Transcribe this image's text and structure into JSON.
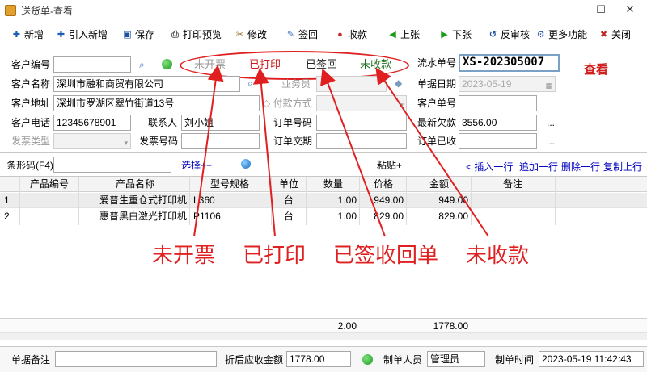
{
  "window": {
    "title": "送货单-查看",
    "min": "—",
    "max": "☐",
    "close": "✕"
  },
  "toolbar": [
    {
      "key": "add",
      "label": "新增",
      "icon": "plus-icon",
      "glyph": "✚",
      "color": "#1a5fb4"
    },
    {
      "key": "import",
      "label": "引入新增",
      "icon": "plus-icon",
      "glyph": "✚",
      "color": "#1a5fb4"
    },
    {
      "key": "save",
      "label": "保存",
      "icon": "floppy-icon",
      "glyph": "▣",
      "color": "#2050a0"
    },
    {
      "key": "print_preview",
      "label": "打印预览",
      "icon": "printer-icon",
      "glyph": "⎙",
      "color": "#555555"
    },
    {
      "key": "modify",
      "label": "修改",
      "icon": "scissors-icon",
      "glyph": "✂",
      "color": "#8a6a20"
    },
    {
      "key": "sign",
      "label": "签回",
      "icon": "sign-icon",
      "glyph": "✎",
      "color": "#3a70c0"
    },
    {
      "key": "receive",
      "label": "收款",
      "icon": "coins-icon",
      "glyph": "●",
      "color": "#c03030"
    },
    {
      "key": "prev",
      "label": "上张",
      "icon": "arrow-left-icon",
      "glyph": "◀",
      "color": "#1a9a1a"
    },
    {
      "key": "next",
      "label": "下张",
      "icon": "arrow-right-icon",
      "glyph": "▶",
      "color": "#1a9a1a"
    },
    {
      "key": "unaudit",
      "label": "反审核",
      "icon": "unaudit-icon",
      "glyph": "↺",
      "color": "#2050a0"
    },
    {
      "key": "more",
      "label": "更多功能",
      "icon": "gear-icon",
      "glyph": "⚙",
      "color": "#2050a0"
    },
    {
      "key": "close",
      "label": "关闭",
      "icon": "close-icon",
      "glyph": "✖",
      "color": "#c02020"
    }
  ],
  "status": {
    "invoice": "未开票",
    "printed": "已打印",
    "signed": "已签回",
    "payment": "未收款"
  },
  "view_mark": "查看",
  "form": {
    "customer_no_label": "客户编号",
    "customer_no": "",
    "customer_name_label": "客户名称",
    "customer_name": "深圳市融和商贸有限公司",
    "salesman_label": "业务员",
    "salesman": "",
    "address_label": "客户地址",
    "address": "深圳市罗湖区翠竹街道13号",
    "pay_method_label": "付款方式",
    "pay_method": "",
    "customer_code_label": "客户单号",
    "customer_code": "",
    "phone_label": "客户电话",
    "phone": "12345678901",
    "contact_label": "联系人",
    "contact": "刘小姐",
    "order_no_label": "订单号码",
    "order_no": "",
    "latest_debt_label": "最新欠款",
    "latest_debt": "3556.00",
    "invoice_type_label": "发票类型",
    "invoice_type": "",
    "invoice_no_label": "发票号码",
    "invoice_no": "",
    "order_date_label": "订单交期",
    "order_date": "",
    "order_received_label": "订单已收",
    "order_received": "",
    "serial_label": "流水单号",
    "serial": "XS-202305007",
    "doc_date_label": "单据日期",
    "doc_date": "2023-05-19"
  },
  "barcode": {
    "label": "条形码(F4)",
    "value": "",
    "select": "选择++",
    "paste": "粘贴+"
  },
  "row_actions": [
    "< 插入一行",
    "追加一行",
    "删除一行",
    "复制上行"
  ],
  "table": {
    "headers": [
      "产品编号",
      "产品名称",
      "型号规格",
      "单位",
      "数量",
      "价格",
      "金额",
      "备注"
    ],
    "rows": [
      {
        "idx": "1",
        "code": "",
        "name": "爱普生重仓式打印机",
        "model": "L360",
        "unit": "台",
        "qty": "1.00",
        "price": "949.00",
        "amount": "949.00",
        "note": ""
      },
      {
        "idx": "2",
        "code": "",
        "name": "惠普黑白激光打印机",
        "model": "P1106",
        "unit": "台",
        "qty": "1.00",
        "price": "829.00",
        "amount": "829.00",
        "note": ""
      }
    ],
    "totals": {
      "qty": "2.00",
      "amount": "1778.00"
    }
  },
  "annotations": [
    "未开票",
    "已打印",
    "已签收回单",
    "未收款"
  ],
  "footer": {
    "note_label": "单据备注",
    "note": "",
    "discount_label": "折后应收金额",
    "discount": "1778.00",
    "maker_label": "制单人员",
    "maker": "管理员",
    "time_label": "制单时间",
    "time": "2023-05-19 11:42:43"
  },
  "colors": {
    "status_red": "#cc2020",
    "status_green": "#207020",
    "annotation": "#e02020",
    "link_blue": "#0000c0"
  }
}
